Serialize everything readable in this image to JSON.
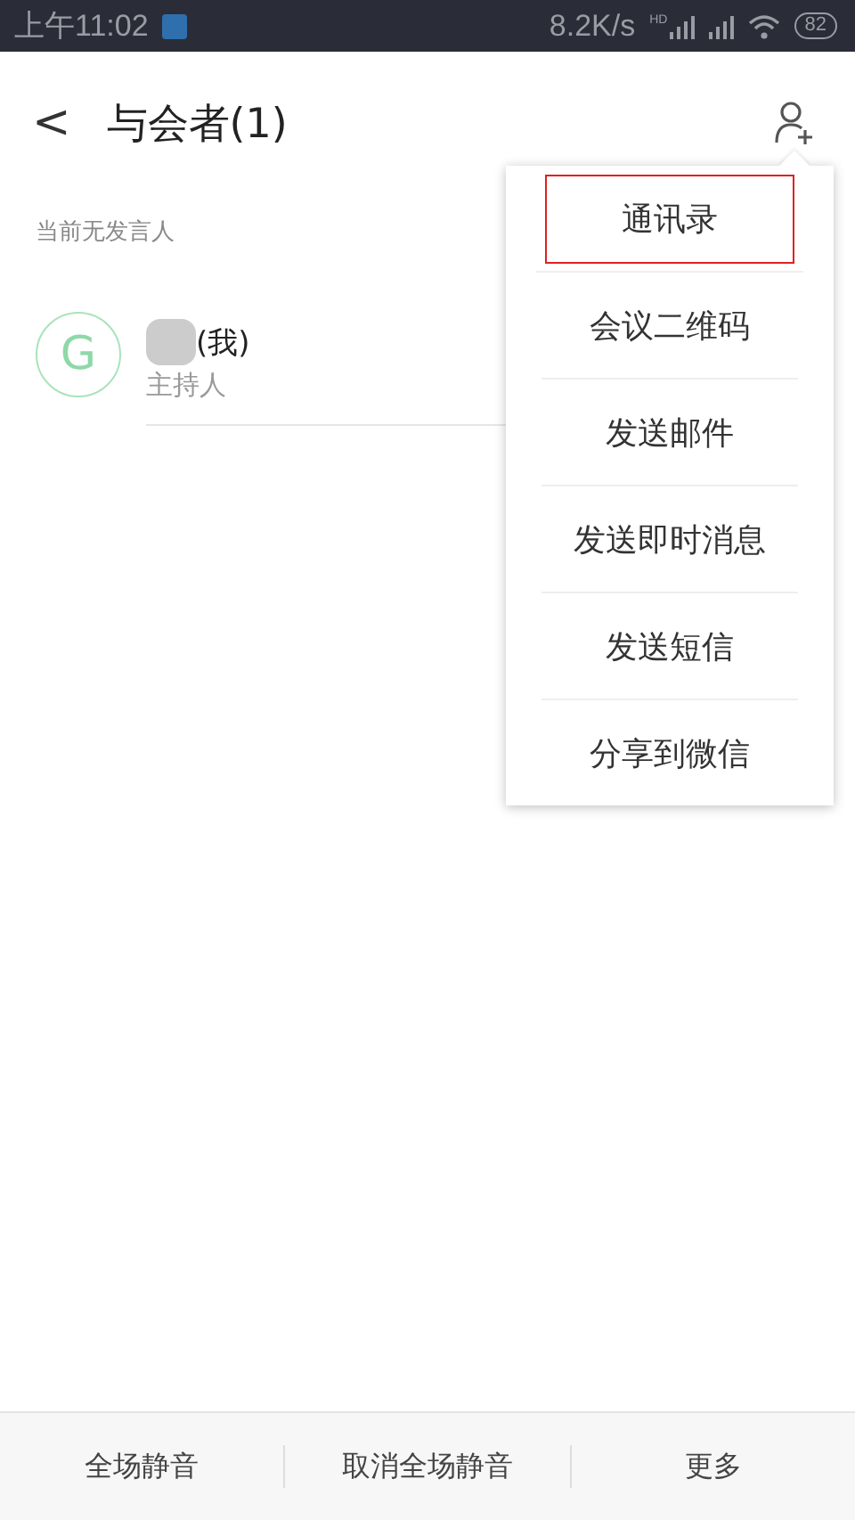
{
  "status_bar": {
    "time": "上午11:02",
    "speed": "8.2K/s",
    "hd": "HD",
    "battery": "82"
  },
  "header": {
    "back": "<",
    "title": "与会者(1)"
  },
  "section_label": "当前无发言人",
  "participants": [
    {
      "name": "(我)",
      "name_redacted": true,
      "role": "主持人",
      "avatar_letter": "G"
    }
  ],
  "menu": [
    {
      "label": "通讯录",
      "highlighted": true
    },
    {
      "label": "会议二维码",
      "highlighted": false
    },
    {
      "label": "发送邮件",
      "highlighted": false
    },
    {
      "label": "发送即时消息",
      "highlighted": false
    },
    {
      "label": "发送短信",
      "highlighted": false
    },
    {
      "label": "分享到微信",
      "highlighted": false
    }
  ],
  "bottom_bar": [
    "全场静音",
    "取消全场静音",
    "更多"
  ]
}
